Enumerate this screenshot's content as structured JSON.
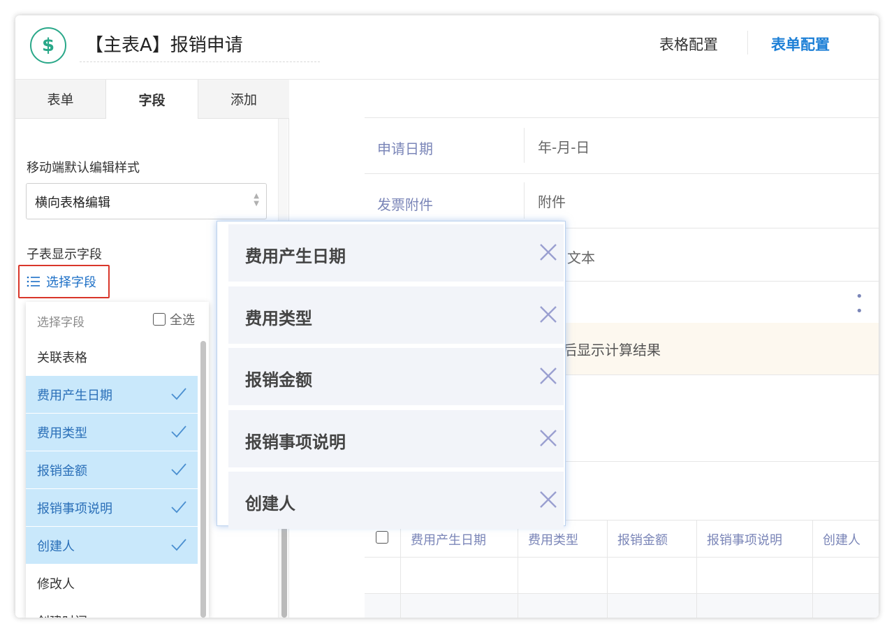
{
  "header": {
    "icon_glyph": "$",
    "title": "【主表A】报销申请",
    "tabs": [
      {
        "label": "表格配置",
        "active": false
      },
      {
        "label": "表单配置",
        "active": true
      }
    ]
  },
  "left_panel": {
    "tabs": [
      {
        "label": "表单"
      },
      {
        "label": "字段"
      },
      {
        "label": "添加"
      }
    ],
    "mobile_style_label": "移动端默认编辑样式",
    "mobile_style_value": "横向表格编辑",
    "subtable_label": "子表显示字段",
    "choose_fields_button": "选择字段"
  },
  "dropdown": {
    "header_label": "选择字段",
    "select_all_label": "全选",
    "items": [
      {
        "label": "关联表格",
        "selected": false
      },
      {
        "label": "费用产生日期",
        "selected": true
      },
      {
        "label": "费用类型",
        "selected": true
      },
      {
        "label": "报销金额",
        "selected": true
      },
      {
        "label": "报销事项说明",
        "selected": true
      },
      {
        "label": "创建人",
        "selected": true
      },
      {
        "label": "修改人",
        "selected": false
      },
      {
        "label": "创建时间",
        "selected": false
      }
    ]
  },
  "form": {
    "rows": [
      {
        "label": "申请日期",
        "value": "年-月-日"
      },
      {
        "label": "发票附件",
        "value": "附件"
      }
    ],
    "partial_text_1": "文本",
    "calc_text": "后显示计算结果",
    "dots": "• •"
  },
  "sub_table": {
    "columns": [
      "费用产生日期",
      "费用类型",
      "报销金额",
      "报销事项说明",
      "创建人"
    ]
  },
  "popover": {
    "chips": [
      {
        "label": "费用产生日期"
      },
      {
        "label": "费用类型"
      },
      {
        "label": "报销金额"
      },
      {
        "label": "报销事项说明"
      },
      {
        "label": "创建人"
      }
    ]
  },
  "colors": {
    "accent_blue": "#1c7fd6",
    "brand_green": "#2aa889",
    "selected_bg": "#c9e8fb",
    "highlight_red": "#d9372b"
  }
}
